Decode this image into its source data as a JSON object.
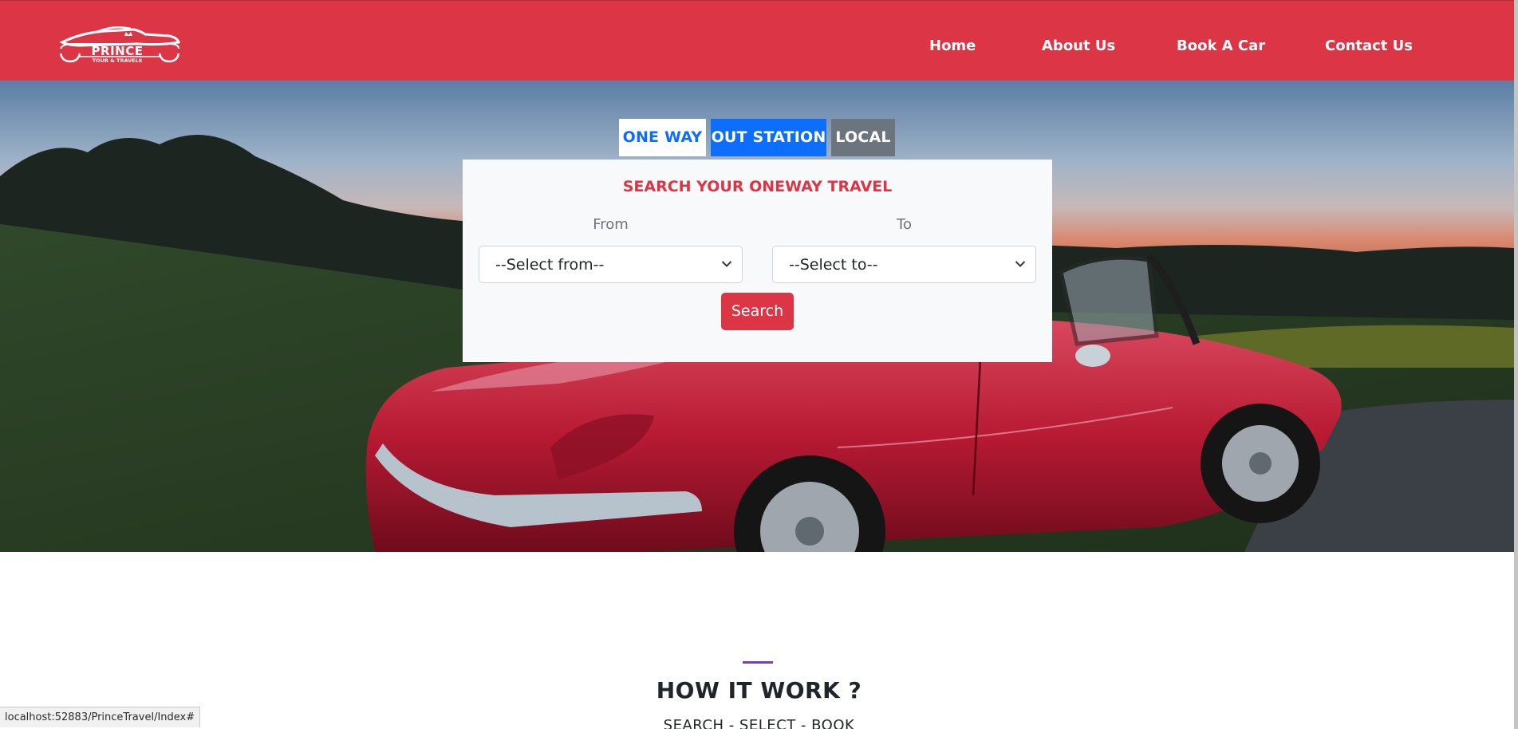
{
  "header": {
    "logo": {
      "name": "PRINCE",
      "tagline": "TOUR & TRAVELS"
    },
    "nav": [
      {
        "label": "Home"
      },
      {
        "label": "About Us"
      },
      {
        "label": "Book A Car"
      },
      {
        "label": "Contact Us"
      }
    ],
    "brand_color": "#dc3545"
  },
  "booking": {
    "tabs": [
      {
        "label": "ONE WAY",
        "state": "active"
      },
      {
        "label": "OUT STATION",
        "state": "primary"
      },
      {
        "label": "LOCAL",
        "state": "secondary"
      }
    ],
    "title": "SEARCH YOUR ONEWAY TRAVEL",
    "from_label": "From",
    "from_value": "--Select from--",
    "to_label": "To",
    "to_value": "--Select to--",
    "search_label": "Search"
  },
  "how_it_works": {
    "title": "HOW IT WORK ?",
    "subtitle": "SEARCH - SELECT - BOOK"
  },
  "status_bar": {
    "url": "localhost:52883/PrinceTravel/Index#"
  },
  "icons": {
    "logo": "car-logo-icon",
    "select_arrow": "chevron-down-icon"
  }
}
